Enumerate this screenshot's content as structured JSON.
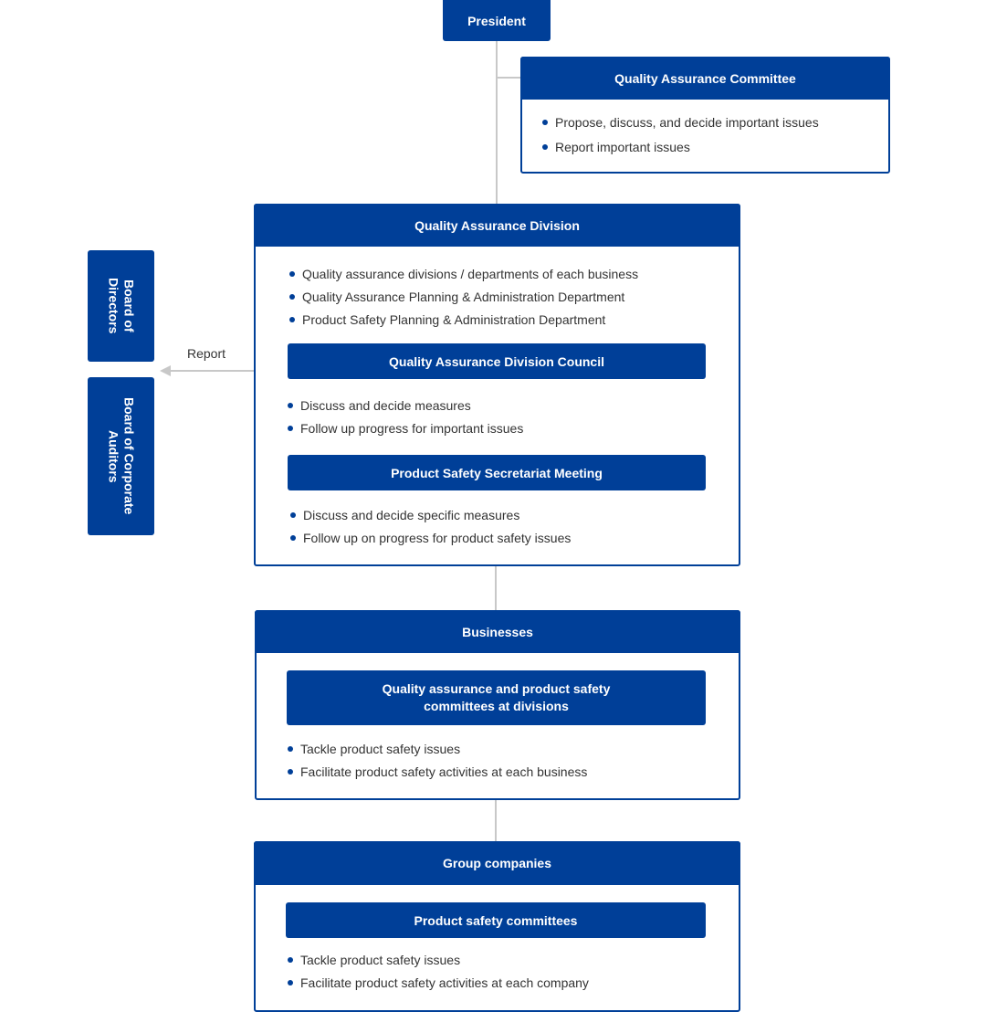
{
  "colors": {
    "primary": "#003f98",
    "connector": "#c8c8c8"
  },
  "president": "President",
  "qac": {
    "title": "Quality Assurance Committee",
    "items": [
      "Propose, discuss, and decide important issues",
      "Report important issues"
    ]
  },
  "qad": {
    "title": "Quality Assurance Division",
    "items": [
      "Quality assurance divisions / departments of each business",
      "Quality Assurance Planning & Administration Department",
      "Product Safety Planning & Administration Department"
    ],
    "council": {
      "title": "Quality Assurance Division Council",
      "items": [
        "Discuss and decide measures",
        "Follow up progress for important issues"
      ]
    },
    "secretariat": {
      "title": "Product Safety Secretariat Meeting",
      "items": [
        "Discuss and decide specific measures",
        "Follow up on progress for product safety issues"
      ]
    }
  },
  "report_label": "Report",
  "board_directors": "Board of Directors",
  "board_auditors": "Board of Corporate Auditors",
  "businesses": {
    "title": "Businesses",
    "sub": {
      "title": "Quality assurance and product safety committees at divisions",
      "items": [
        "Tackle product safety issues",
        "Facilitate product safety activities at each business"
      ]
    }
  },
  "group": {
    "title": "Group companies",
    "sub": {
      "title": "Product safety committees",
      "items": [
        "Tackle product safety issues",
        "Facilitate product safety activities at each company"
      ]
    }
  }
}
